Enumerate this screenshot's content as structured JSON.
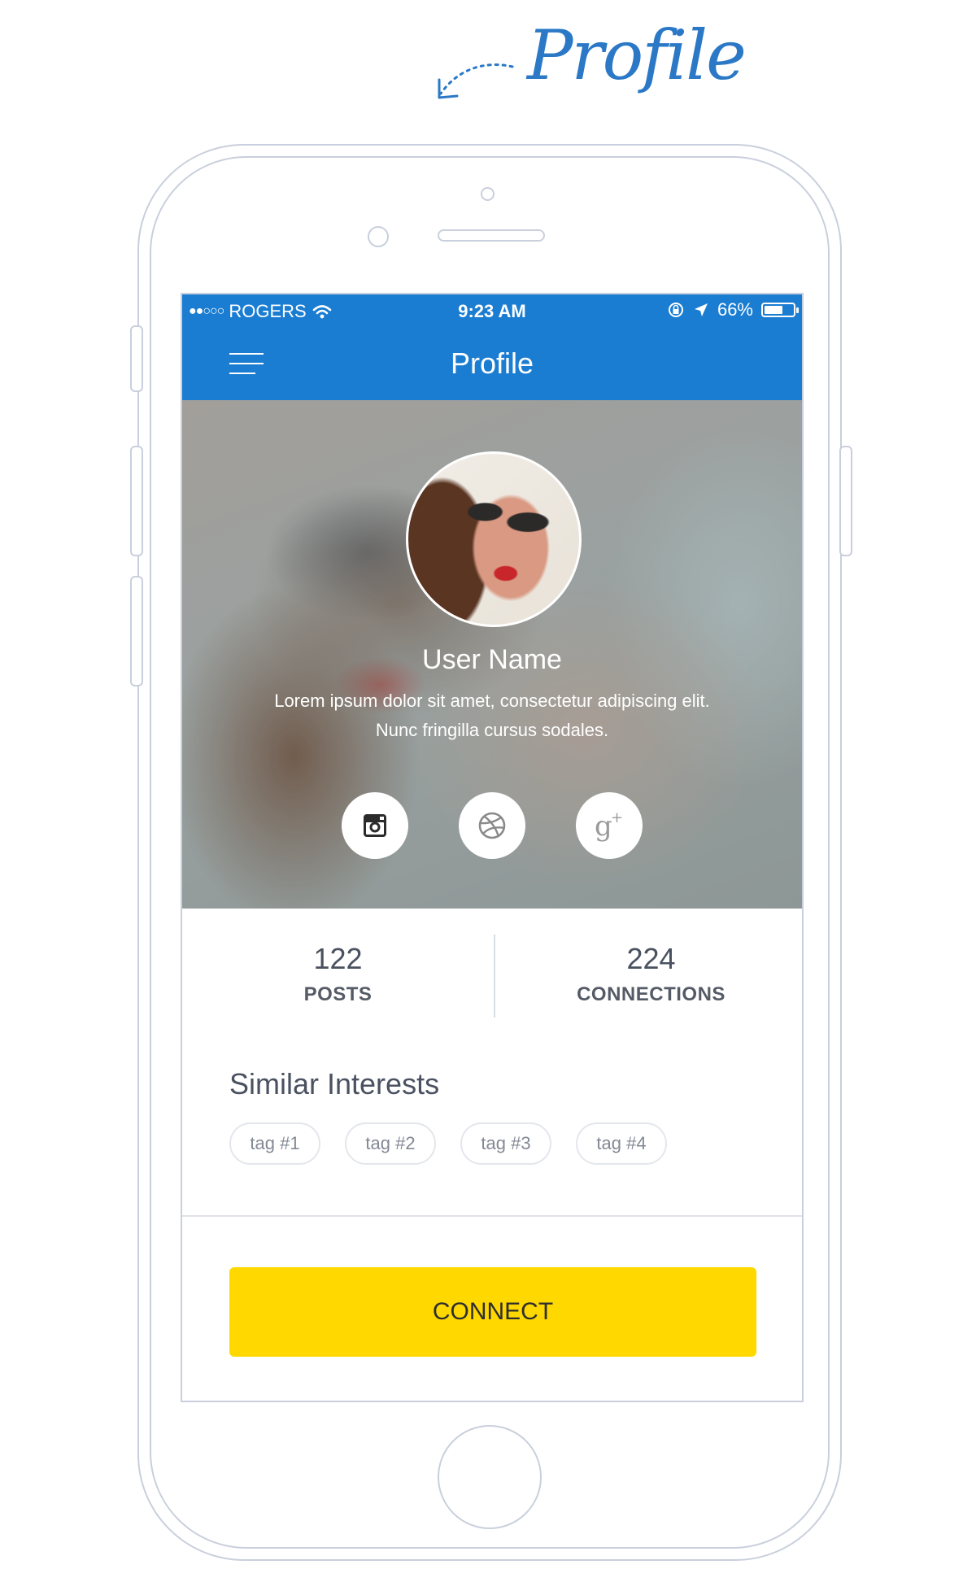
{
  "annotation": {
    "label": "Profile"
  },
  "status_bar": {
    "signal": "●●○○○",
    "carrier": "ROGERS",
    "time": "9:23 AM",
    "battery_percent": "66%",
    "battery_level": 0.66
  },
  "nav": {
    "title": "Profile"
  },
  "profile": {
    "name": "User Name",
    "bio_line1": "Lorem ipsum dolor sit amet, consectetur adipiscing elit.",
    "bio_line2": "Nunc fringilla cursus sodales."
  },
  "social": [
    {
      "name": "instagram-icon"
    },
    {
      "name": "dribbble-icon"
    },
    {
      "name": "google-plus-icon"
    }
  ],
  "stats": {
    "posts_value": "122",
    "posts_label": "POSTS",
    "connections_value": "224",
    "connections_label": "CONNECTIONS"
  },
  "interests": {
    "title": "Similar Interests",
    "tags": [
      "tag #1",
      "tag #2",
      "tag #3",
      "tag #4"
    ]
  },
  "connect_label": "CONNECT",
  "colors": {
    "accent": "#1a7dd2",
    "button": "#ffd800",
    "outline": "#c9cfdc"
  }
}
